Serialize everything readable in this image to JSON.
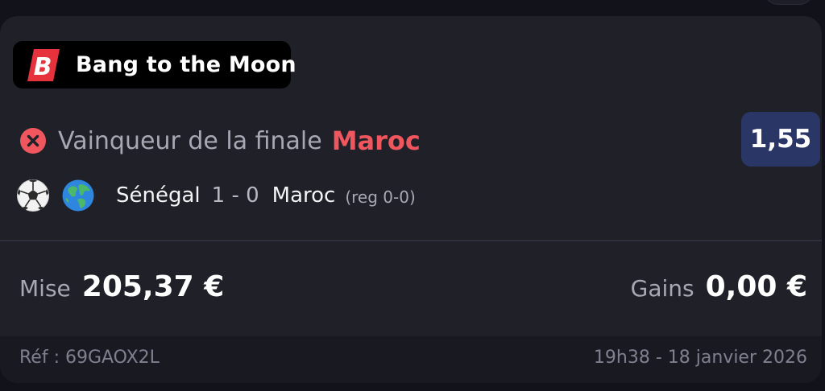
{
  "bet": {
    "operator": "Bang to the Moon",
    "status_icon": "cross-circle-icon",
    "market": "Vainqueur de la finale",
    "pick": "Maroc",
    "odds": "1,55",
    "match": {
      "sport_icon": "soccer-ball-icon",
      "competition_icon": "globe-icon",
      "home_team": "Sénégal",
      "score": "1 - 0",
      "away_team": "Maroc",
      "regular_time": "(reg 0-0)"
    },
    "stake_label": "Mise",
    "stake_amount": "205,37 €",
    "winnings_label": "Gains",
    "winnings_amount": "0,00 €",
    "reference": "Réf : 69GAOX2L",
    "datetime": "19h38 - 18 janvier 2026"
  },
  "colors": {
    "background": "#12121a",
    "card": "#1f2028",
    "footer": "#191a21",
    "lost_red": "#f0565e",
    "odds_badge": "#2a3766",
    "logo_red": "#e5323c"
  }
}
